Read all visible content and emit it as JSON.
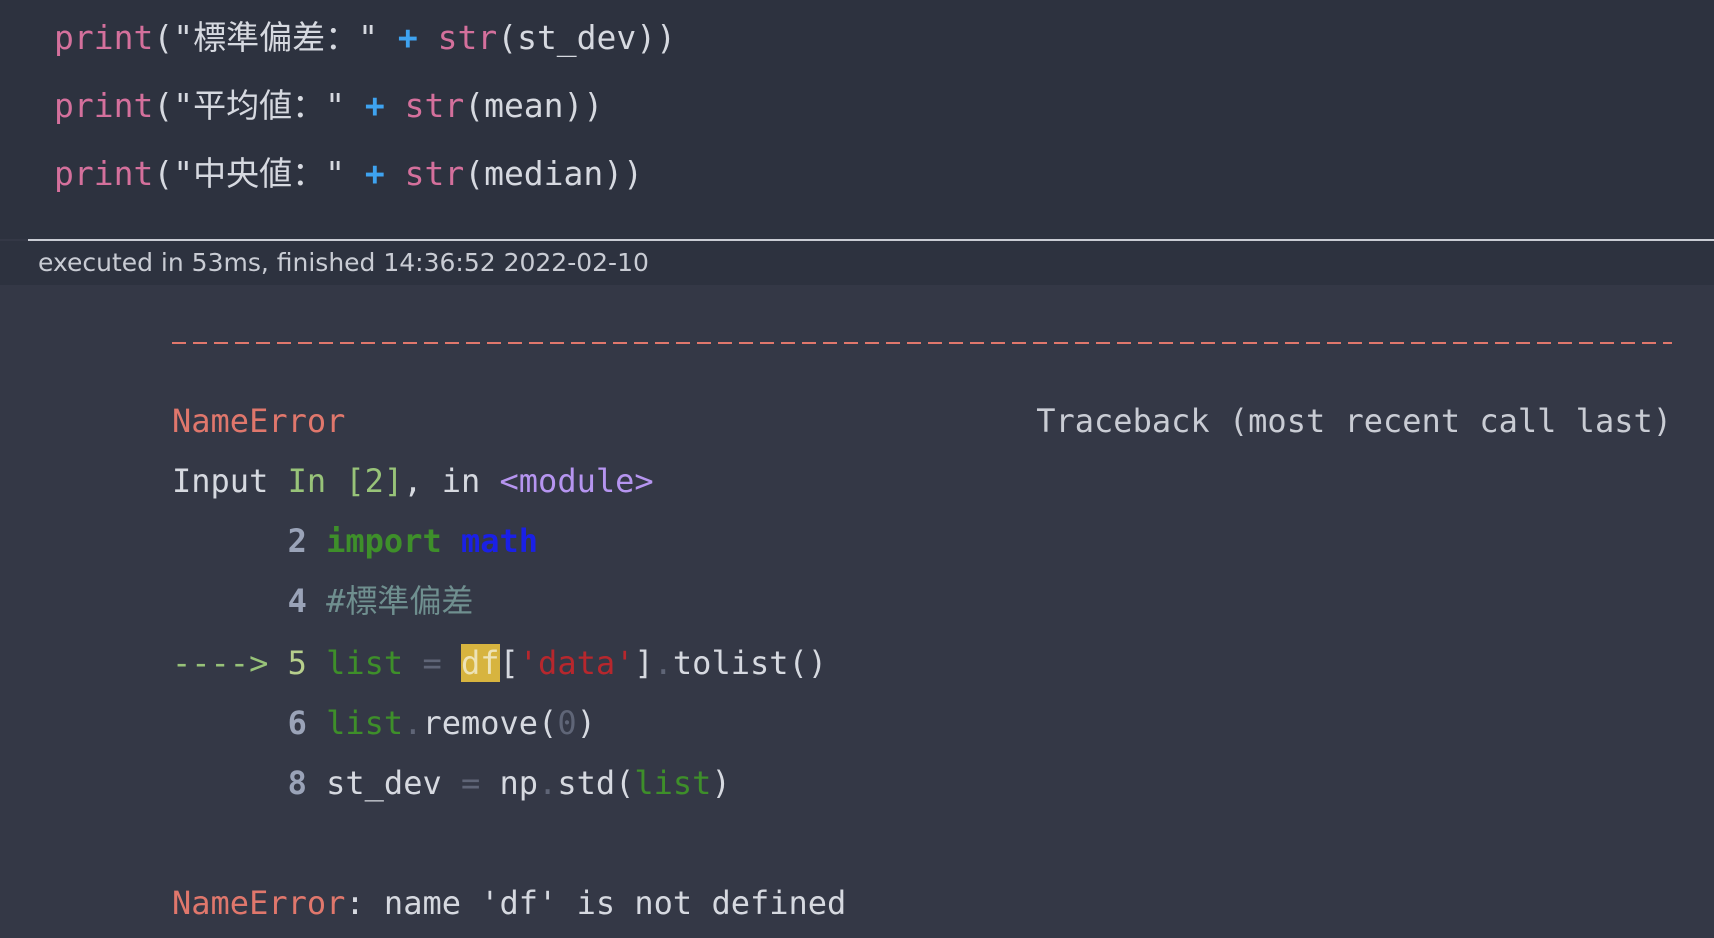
{
  "code_cell": {
    "lines": [
      {
        "fn": "print",
        "paren_open": "(",
        "string": "\"標準偏差：\"",
        "plus": "+",
        "conv": "str",
        "arg": "(st_dev))"
      },
      {
        "fn": "print",
        "paren_open": "(",
        "string": "\"平均値：\"",
        "plus": "+",
        "conv": "str",
        "arg": "(mean))"
      },
      {
        "fn": "print",
        "paren_open": "(",
        "string": "\"中央値：\"",
        "plus": "+",
        "conv": "str",
        "arg": "(median))"
      }
    ]
  },
  "exec_info": "executed in 53ms, finished 14:36:52 2022-02-10",
  "traceback": {
    "error_name": "NameError",
    "traceback_label": "Traceback (most recent call last)",
    "input_prefix": "Input ",
    "input_in": "In [2]",
    "input_mid": ", in ",
    "input_module": "<module>",
    "lines": {
      "l2": {
        "no": "2",
        "kw": "import",
        "mod": "math"
      },
      "l4": {
        "no": "4",
        "comment": "#標準偏差"
      },
      "l5": {
        "arrow": "---->",
        "no": "5",
        "var": "list",
        "eq": "=",
        "hl": "df",
        "open": "[",
        "str": "'data'",
        "close": "]",
        "dot": ".",
        "call": "tolist()"
      },
      "l6": {
        "no": "6",
        "var": "list",
        "dot": ".",
        "call": "remove(",
        "num": "0",
        "close": ")"
      },
      "l8": {
        "no": "8",
        "lhs": "st_dev",
        "eq": "=",
        "obj": "np",
        "dot": ".",
        "call": "std(",
        "arg": "list",
        "close": ")"
      }
    },
    "final_name": "NameError",
    "final_msg": ": name 'df' is not defined"
  }
}
